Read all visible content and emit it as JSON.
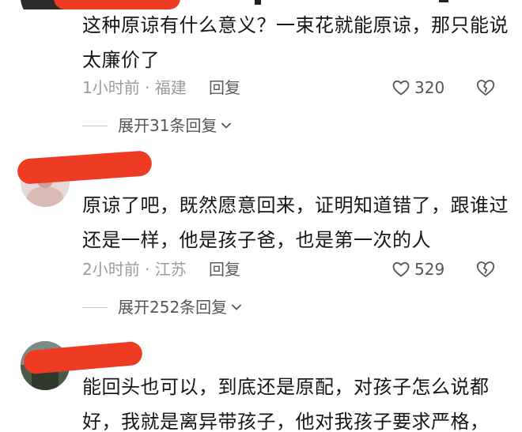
{
  "comments": [
    {
      "text": "这种原谅有什么意义？一束花就能原谅，那只能说太廉价了",
      "time_location": "1小时前 · 福建",
      "reply_label": "回复",
      "likes": "320",
      "expand_label": "展开31条回复"
    },
    {
      "text": "原谅了吧，既然愿意回来，证明知道错了，跟谁过还是一样，他是孩子爸，也是第一次的人",
      "time_location": "2小时前 · 江苏",
      "reply_label": "回复",
      "likes": "529",
      "expand_label": "展开252条回复"
    },
    {
      "text": "能回头也可以，到底还是原配，对孩子怎么说都好，我就是离异带孩子，他对我孩子要求严格，",
      "time_location": "",
      "reply_label": "",
      "likes": "",
      "expand_label": ""
    }
  ],
  "icons": {
    "like": "heart-outline-icon",
    "dislike": "broken-heart-icon",
    "expand": "chevron-down-icon"
  },
  "colors": {
    "redaction": "#ee3b24",
    "text": "#161616",
    "meta": "#9b9b9b"
  }
}
